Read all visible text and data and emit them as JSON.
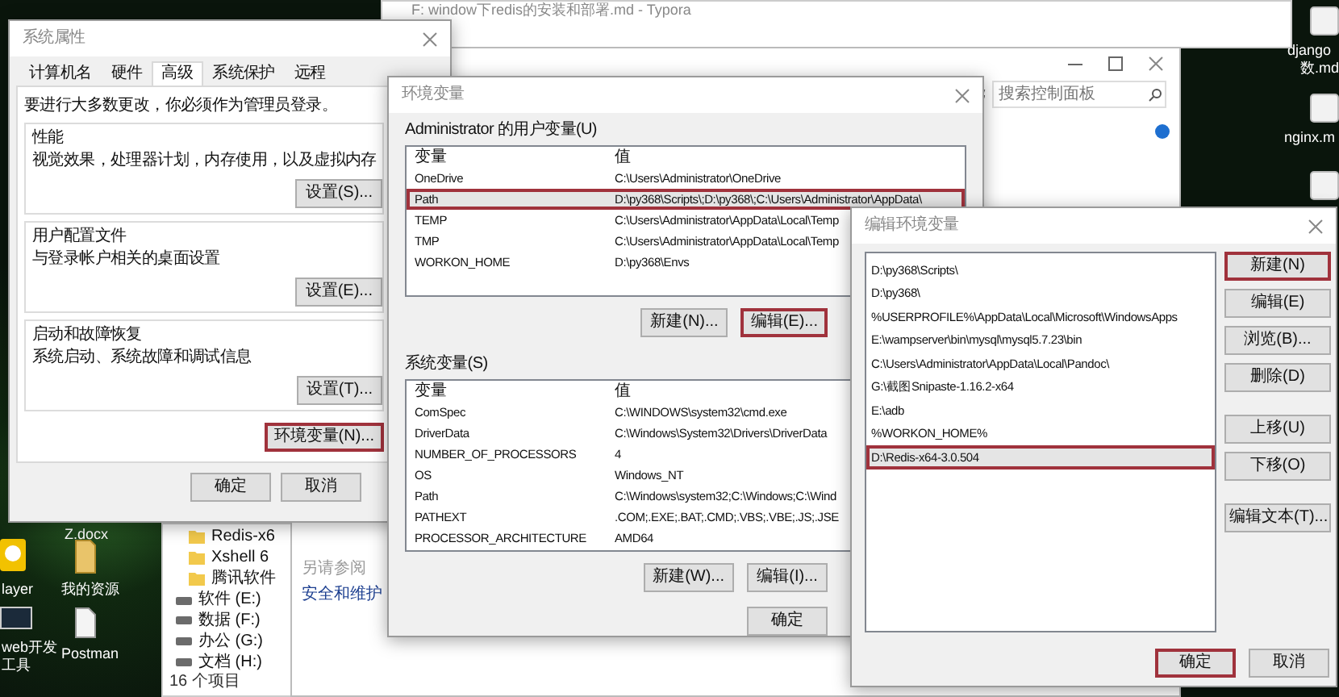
{
  "desktop": {
    "left_icons": [
      {
        "lines": [
          "Z.docx"
        ]
      },
      {
        "lines": [
          "layer"
        ]
      },
      {
        "lines": [
          "我的资源"
        ]
      },
      {
        "lines": [
          "web开发",
          "工具"
        ]
      },
      {
        "lines": [
          "Postman"
        ]
      }
    ],
    "right_icons": [
      {
        "lines": [
          "django",
          "数.md"
        ]
      },
      {
        "lines": [
          "nginx.m"
        ]
      }
    ]
  },
  "typora": {
    "title": "F: window下redis的安装和部署.md - Typora"
  },
  "control_panel": {
    "search": {
      "placeholder": "搜索控制面板"
    },
    "see_also": "另请参阅",
    "links": [
      "安全和维护"
    ]
  },
  "explorer": {
    "items": [
      {
        "label": "Redis-x6",
        "kind": "folder"
      },
      {
        "label": "Xshell 6",
        "kind": "folder"
      },
      {
        "label": "腾讯软件",
        "kind": "folder"
      },
      {
        "label": "软件 (E:)",
        "kind": "drive"
      },
      {
        "label": "数据 (F:)",
        "kind": "drive"
      },
      {
        "label": "办公 (G:)",
        "kind": "drive"
      },
      {
        "label": "文档 (H:)",
        "kind": "drive"
      }
    ],
    "status": "16 个项目"
  },
  "system_properties": {
    "title": "系统属性",
    "tabs": [
      {
        "label": "计算机名",
        "selected": false
      },
      {
        "label": "硬件",
        "selected": false
      },
      {
        "label": "高级",
        "selected": true
      },
      {
        "label": "系统保护",
        "selected": false
      },
      {
        "label": "远程",
        "selected": false
      }
    ],
    "notice": "要进行大多数更改，你必须作为管理员登录。",
    "groups": [
      {
        "title": "性能",
        "description": "视觉效果，处理器计划，内存使用，以及虚拟内存",
        "button": "设置(S)..."
      },
      {
        "title": "用户配置文件",
        "description": "与登录帐户相关的桌面设置",
        "button": "设置(E)..."
      },
      {
        "title": "启动和故障恢复",
        "description": "系统启动、系统故障和调试信息",
        "button": "设置(T)..."
      }
    ],
    "env_button": {
      "label": "环境变量(N)...",
      "highlighted": true
    },
    "buttons": [
      {
        "label": "确定",
        "highlighted": false
      },
      {
        "label": "取消",
        "highlighted": false
      }
    ]
  },
  "env_vars": {
    "title": "环境变量",
    "user_label": "Administrator 的用户变量(U)",
    "user_columns": [
      "变量",
      "值"
    ],
    "user_rows": [
      {
        "name": "OneDrive",
        "value": "C:\\Users\\Administrator\\OneDrive",
        "selected": false,
        "highlighted": false
      },
      {
        "name": "Path",
        "value": "D:\\py368\\Scripts\\;D:\\py368\\;C:\\Users\\Administrator\\AppData\\",
        "selected": true,
        "highlighted": true
      },
      {
        "name": "TEMP",
        "value": "C:\\Users\\Administrator\\AppData\\Local\\Temp",
        "selected": false,
        "highlighted": false
      },
      {
        "name": "TMP",
        "value": "C:\\Users\\Administrator\\AppData\\Local\\Temp",
        "selected": false,
        "highlighted": false
      },
      {
        "name": "WORKON_HOME",
        "value": "D:\\py368\\Envs",
        "selected": false,
        "highlighted": false
      }
    ],
    "user_buttons": [
      {
        "label": "新建(N)...",
        "highlighted": false
      },
      {
        "label": "编辑(E)...",
        "highlighted": true
      }
    ],
    "system_label": "系统变量(S)",
    "system_columns": [
      "变量",
      "值"
    ],
    "system_rows": [
      {
        "name": "ComSpec",
        "value": "C:\\WINDOWS\\system32\\cmd.exe",
        "selected": false,
        "highlighted": false
      },
      {
        "name": "DriverData",
        "value": "C:\\Windows\\System32\\Drivers\\DriverData",
        "selected": false,
        "highlighted": false
      },
      {
        "name": "NUMBER_OF_PROCESSORS",
        "value": "4",
        "selected": false,
        "highlighted": false
      },
      {
        "name": "OS",
        "value": "Windows_NT",
        "selected": false,
        "highlighted": false
      },
      {
        "name": "Path",
        "value": "C:\\Windows\\system32;C:\\Windows;C:\\Wind",
        "selected": false,
        "highlighted": false
      },
      {
        "name": "PATHEXT",
        "value": ".COM;.EXE;.BAT;.CMD;.VBS;.VBE;.JS;.JSE",
        "selected": false,
        "highlighted": false
      },
      {
        "name": "PROCESSOR_ARCHITECTURE",
        "value": "AMD64",
        "selected": false,
        "highlighted": false
      }
    ],
    "system_buttons": [
      {
        "label": "新建(W)...",
        "highlighted": false
      },
      {
        "label": "编辑(I)...",
        "highlighted": false
      }
    ],
    "buttons": [
      {
        "label": "确定",
        "highlighted": false
      }
    ]
  },
  "edit_env_var": {
    "title": "编辑环境变量",
    "entries": [
      {
        "text": "D:\\py368\\Scripts\\",
        "selected": false,
        "highlighted": false
      },
      {
        "text": "D:\\py368\\",
        "selected": false,
        "highlighted": false
      },
      {
        "text": "%USERPROFILE%\\AppData\\Local\\Microsoft\\WindowsApps",
        "selected": false,
        "highlighted": false
      },
      {
        "text": "E:\\wampserver\\bin\\mysql\\mysql5.7.23\\bin",
        "selected": false,
        "highlighted": false
      },
      {
        "text": "C:\\Users\\Administrator\\AppData\\Local\\Pandoc\\",
        "selected": false,
        "highlighted": false
      },
      {
        "text": "G:\\截图Snipaste-1.16.2-x64",
        "selected": false,
        "highlighted": false
      },
      {
        "text": "E:\\adb",
        "selected": false,
        "highlighted": false
      },
      {
        "text": "%WORKON_HOME%",
        "selected": false,
        "highlighted": false
      },
      {
        "text": "D:\\Redis-x64-3.0.504",
        "selected": true,
        "highlighted": true
      }
    ],
    "side_button_groups": [
      [
        {
          "label": "新建(N)",
          "highlighted": true
        },
        {
          "label": "编辑(E)",
          "highlighted": false
        },
        {
          "label": "浏览(B)...",
          "highlighted": false
        },
        {
          "label": "删除(D)",
          "highlighted": false
        }
      ],
      [
        {
          "label": "上移(U)",
          "highlighted": false
        },
        {
          "label": "下移(O)",
          "highlighted": false
        }
      ],
      [
        {
          "label": "编辑文本(T)...",
          "highlighted": false
        }
      ]
    ],
    "buttons": [
      {
        "label": "确定",
        "highlighted": true
      },
      {
        "label": "取消",
        "highlighted": false
      }
    ]
  }
}
